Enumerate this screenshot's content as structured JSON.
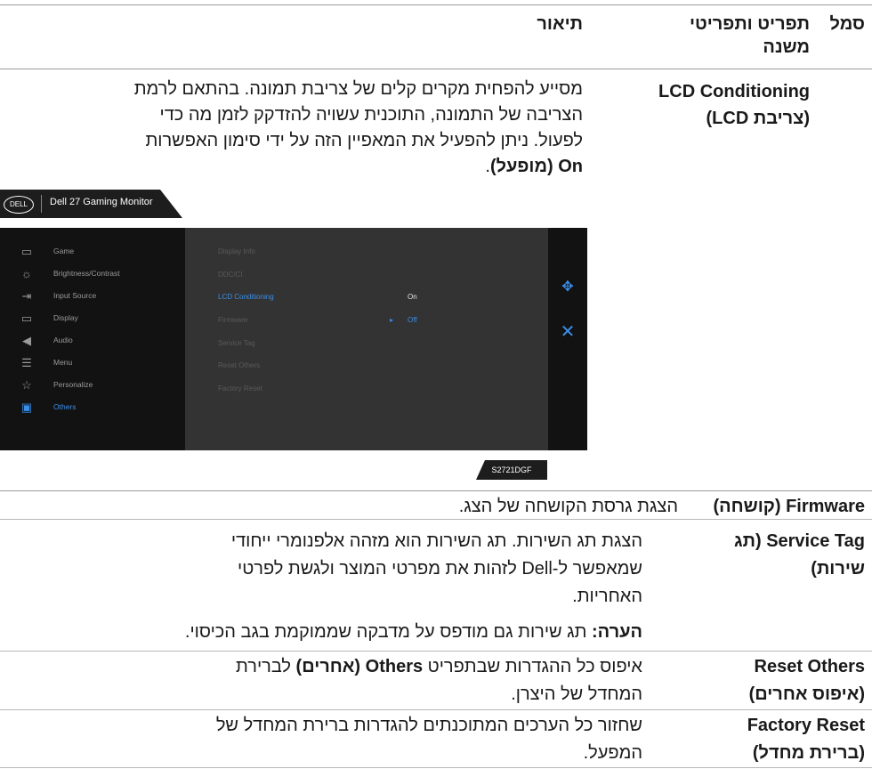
{
  "headers": {
    "symbol": "סמל",
    "menu": "תפריט ותפריטי משנה",
    "description": "תיאור"
  },
  "lcd": {
    "title_en": "LCD Conditioning",
    "title_he": "(צריבת LCD)",
    "line1": "מסייע להפחית מקרים קלים של צריבת תמונה. בהתאם לרמת",
    "line2": "הצריבה של התמונה, התוכנית עשויה להזדקק לזמן מה כדי",
    "line3": "לפעול. ניתן להפעיל את המאפיין הזה על ידי סימון האפשרות",
    "line4_bold": "On (מופעל)",
    "line4_end": "."
  },
  "osd": {
    "logo": "DELL",
    "title": "Dell 27 Gaming Monitor",
    "menu": [
      "Game",
      "Brightness/Contrast",
      "Input Source",
      "Display",
      "Audio",
      "Menu",
      "Personalize",
      "Others"
    ],
    "submenu": [
      "Display Info",
      "DDC/CI",
      "LCD Conditioning",
      "Firmware",
      "Service Tag",
      "Reset Others",
      "Factory Reset"
    ],
    "option_on": "On",
    "option_off": "Off",
    "model": "S2721DGF"
  },
  "firmware": {
    "title": "Firmware (קושחה)",
    "desc": "הצגת גרסת הקושחה של הצג."
  },
  "service": {
    "title_a": "Service Tag (תג",
    "title_b": "שירות)",
    "line1": "הצגת תג השירות. תג השירות הוא מזהה אלפנומרי ייחודי",
    "line2": "שמאפשר ל-Dell לזהות את מפרטי המוצר ולגשת לפרטי",
    "line3": "האחריות.",
    "note_label": "הערה:",
    "note": " תג שירות גם מודפס על מדבקה שממוקמת בגב הכיסוי."
  },
  "reset_others": {
    "title_en": "Reset Others",
    "title_he": "(איפוס אחרים)",
    "line1_a": "איפוס כל ההגדרות שבתפריט ",
    "line1_bold": "Others (אחרים)",
    "line1_b": " לברירת",
    "line2": "המחדל של היצרן."
  },
  "factory_reset": {
    "title_en": "Factory Reset",
    "title_he": "(ברירת מחדל)",
    "line1": "שחזור כל הערכים המתוכנתים להגדרות ברירת המחדל של",
    "line2": "המפעל."
  }
}
